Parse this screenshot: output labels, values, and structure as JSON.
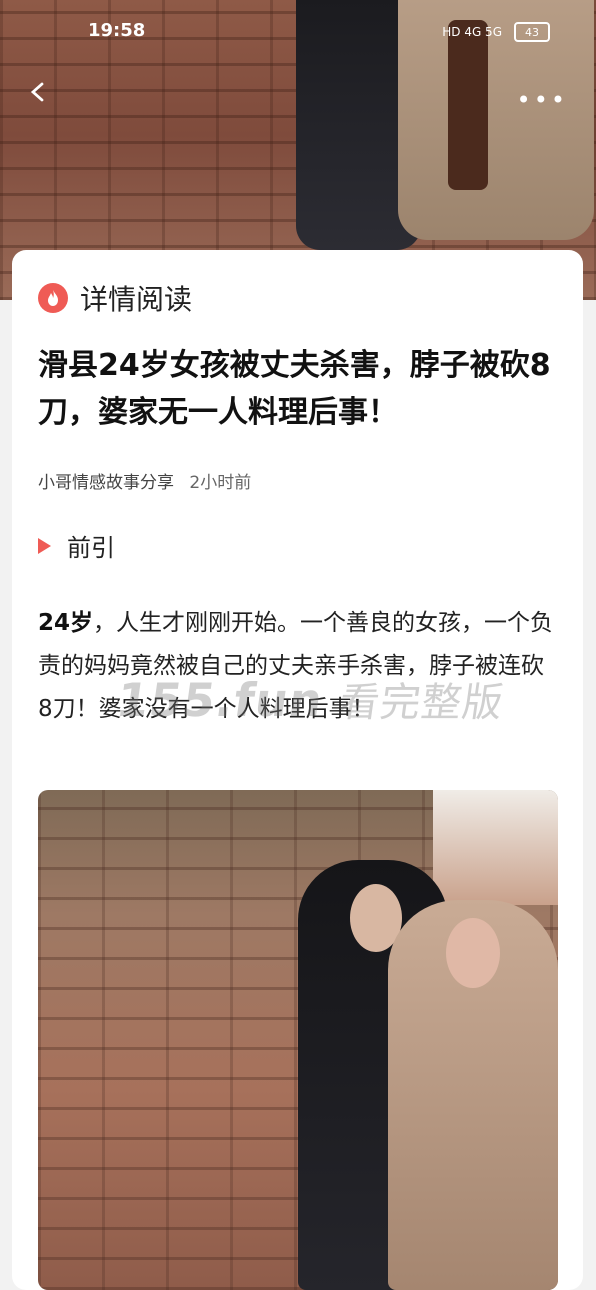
{
  "status_bar": {
    "time": "19:58",
    "network": "HD 4G 5G",
    "battery": "43"
  },
  "header": {
    "back_icon": "back-arrow-icon",
    "more_icon": "more-dots-icon"
  },
  "card": {
    "reader_title": "详情阅读",
    "headline": "滑县24岁女孩被丈夫杀害，脖子被砍8刀，婆家无一人料理后事！",
    "author": "小哥情感故事分享",
    "time_ago": "2小时前",
    "section_label": "前引",
    "body_lead": "24岁",
    "body_text": "，人生才刚刚开始。一个善良的女孩，一个负责的妈妈竟然被自己的丈夫亲手杀害，脖子被连砍8刀！婆家没有一个人料理后事！"
  },
  "watermark": {
    "text_a": "155.fun",
    "text_b": "看完整版"
  },
  "colors": {
    "accent": "#ef5b55",
    "text": "#111111",
    "background": "#ffffff"
  }
}
